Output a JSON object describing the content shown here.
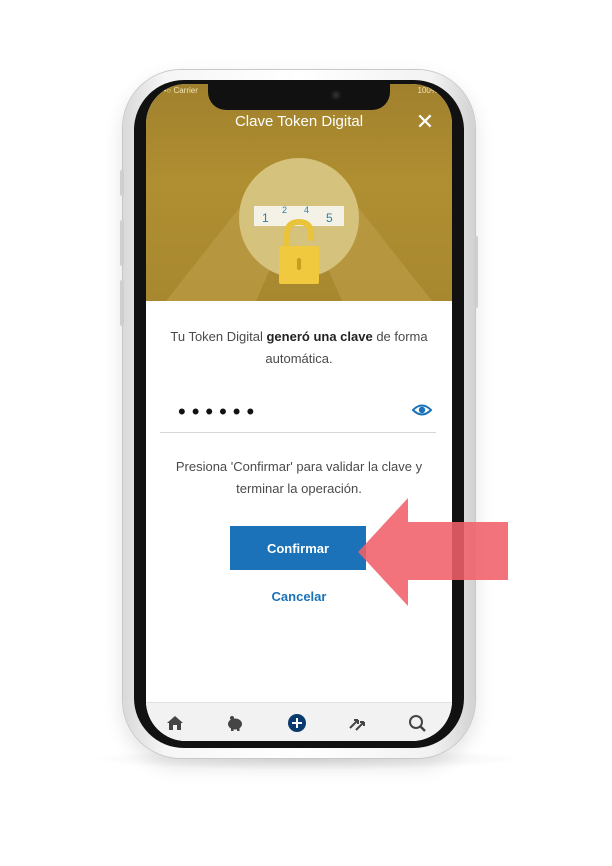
{
  "status_bar": {
    "carrier": "•••○ Carrier",
    "battery": "100%"
  },
  "header": {
    "title": "Clave Token Digital"
  },
  "illustration": {
    "digits": [
      "1",
      "2",
      "4",
      "5"
    ]
  },
  "message": {
    "part1": "Tu Token Digital ",
    "bold": "generó una clave",
    "part2": " de forma automática."
  },
  "password": {
    "masked": "••••••"
  },
  "instruction": "Presiona 'Confirmar' para validar la clave y terminar la operación.",
  "buttons": {
    "confirm": "Confirmar",
    "cancel": "Cancelar"
  },
  "tabbar": {
    "icons": [
      "home-icon",
      "piggy-bank-icon",
      "plus-circle-icon",
      "transfer-icon",
      "search-icon"
    ]
  },
  "colors": {
    "header_gold": "#a8882f",
    "primary_blue": "#1b72b9",
    "arrow_red": "#f0606a"
  }
}
